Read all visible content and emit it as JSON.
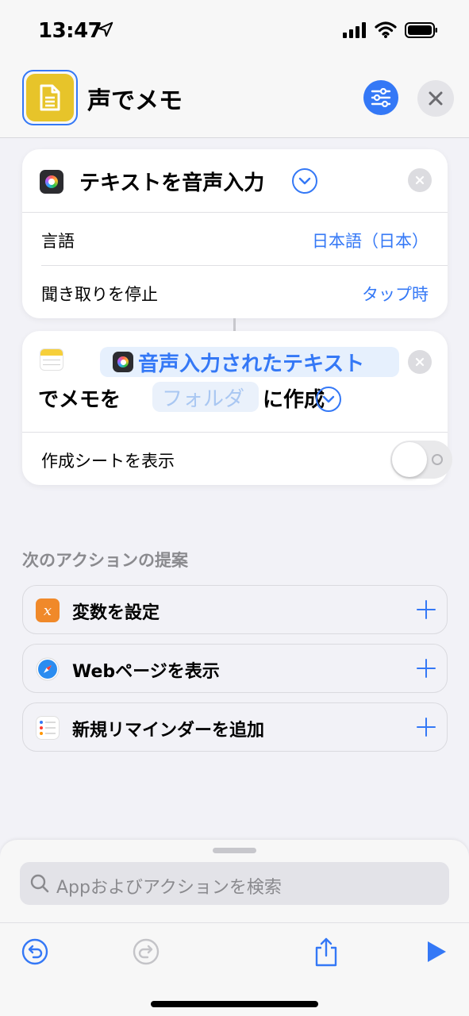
{
  "status": {
    "time": "13:47"
  },
  "header": {
    "title": "声でメモ"
  },
  "action1": {
    "title": "テキストを音声入力",
    "rows": [
      {
        "label": "言語",
        "value": "日本語（日本）"
      },
      {
        "label": "聞き取りを停止",
        "value": "タップ時"
      }
    ]
  },
  "action2": {
    "variable": "音声入力されたテキスト",
    "text_before": "でメモを",
    "folder_placeholder": "フォルダ",
    "text_after": "に作成",
    "toggle_label": "作成シートを表示",
    "toggle_on": false
  },
  "suggestions": {
    "title": "次のアクションの提案",
    "items": [
      {
        "label": "変数を設定",
        "icon": "variable-icon",
        "color": "#f0892a"
      },
      {
        "label": "Webページを表示",
        "icon": "safari-icon",
        "color": "#2a8cf0"
      },
      {
        "label": "新規リマインダーを追加",
        "icon": "reminders-icon",
        "color": "#ffffff"
      }
    ]
  },
  "search": {
    "placeholder": "Appおよびアクションを検索"
  },
  "colors": {
    "accent": "#3478f6",
    "app_icon": "#e7c42a"
  }
}
